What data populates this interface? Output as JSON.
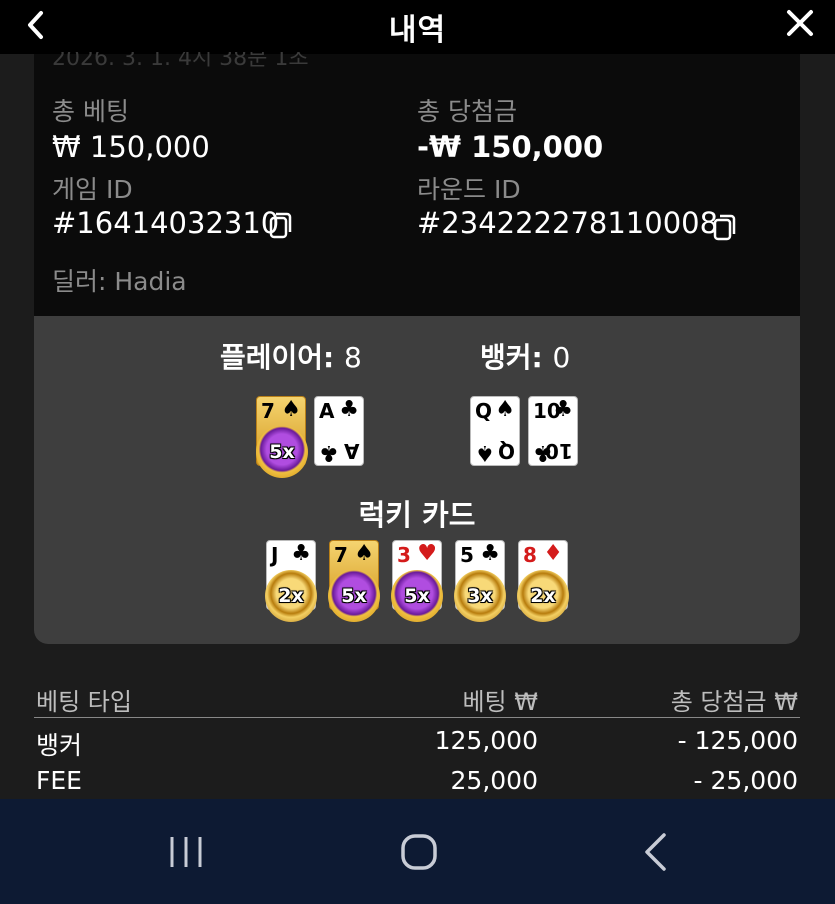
{
  "header": {
    "title": "내역"
  },
  "summary": {
    "date_cut": "2026. 3. 1. 4시 38분 1초",
    "total_bet_label": "총 베팅",
    "total_bet_value": "₩ 150,000",
    "total_win_label": "총 당첨금",
    "total_win_value": "-₩ 150,000",
    "game_id_label": "게임 ID",
    "game_id_value": "#16414032310",
    "round_id_label": "라운드 ID",
    "round_id_value": "#234222278110008",
    "dealer": "딜러: Hadia"
  },
  "result": {
    "player_label": "플레이어:",
    "player_score": "8",
    "banker_label": "뱅커:",
    "banker_score": "0",
    "player_cards": [
      {
        "rank": "7",
        "suit": "♠",
        "multiplier": "5x"
      },
      {
        "rank": "A",
        "suit": "♣"
      }
    ],
    "banker_cards": [
      {
        "rank": "Q",
        "suit": "♠"
      },
      {
        "rank": "10",
        "suit": "♣"
      }
    ],
    "lucky_title": "럭키 카드",
    "lucky_cards": [
      {
        "rank": "J",
        "suit": "♣",
        "multiplier": "2x"
      },
      {
        "rank": "7",
        "suit": "♠",
        "multiplier": "5x"
      },
      {
        "rank": "3",
        "suit": "♥",
        "multiplier": "5x"
      },
      {
        "rank": "5",
        "suit": "♣",
        "multiplier": "3x"
      },
      {
        "rank": "8",
        "suit": "♦",
        "multiplier": "2x"
      }
    ]
  },
  "bets": {
    "headers": [
      "베팅 타입",
      "베팅 ₩",
      "총 당첨금 ₩"
    ],
    "rows": [
      [
        "뱅커",
        "125,000",
        "- 125,000"
      ],
      [
        "FEE",
        "25,000",
        "- 25,000"
      ]
    ]
  }
}
